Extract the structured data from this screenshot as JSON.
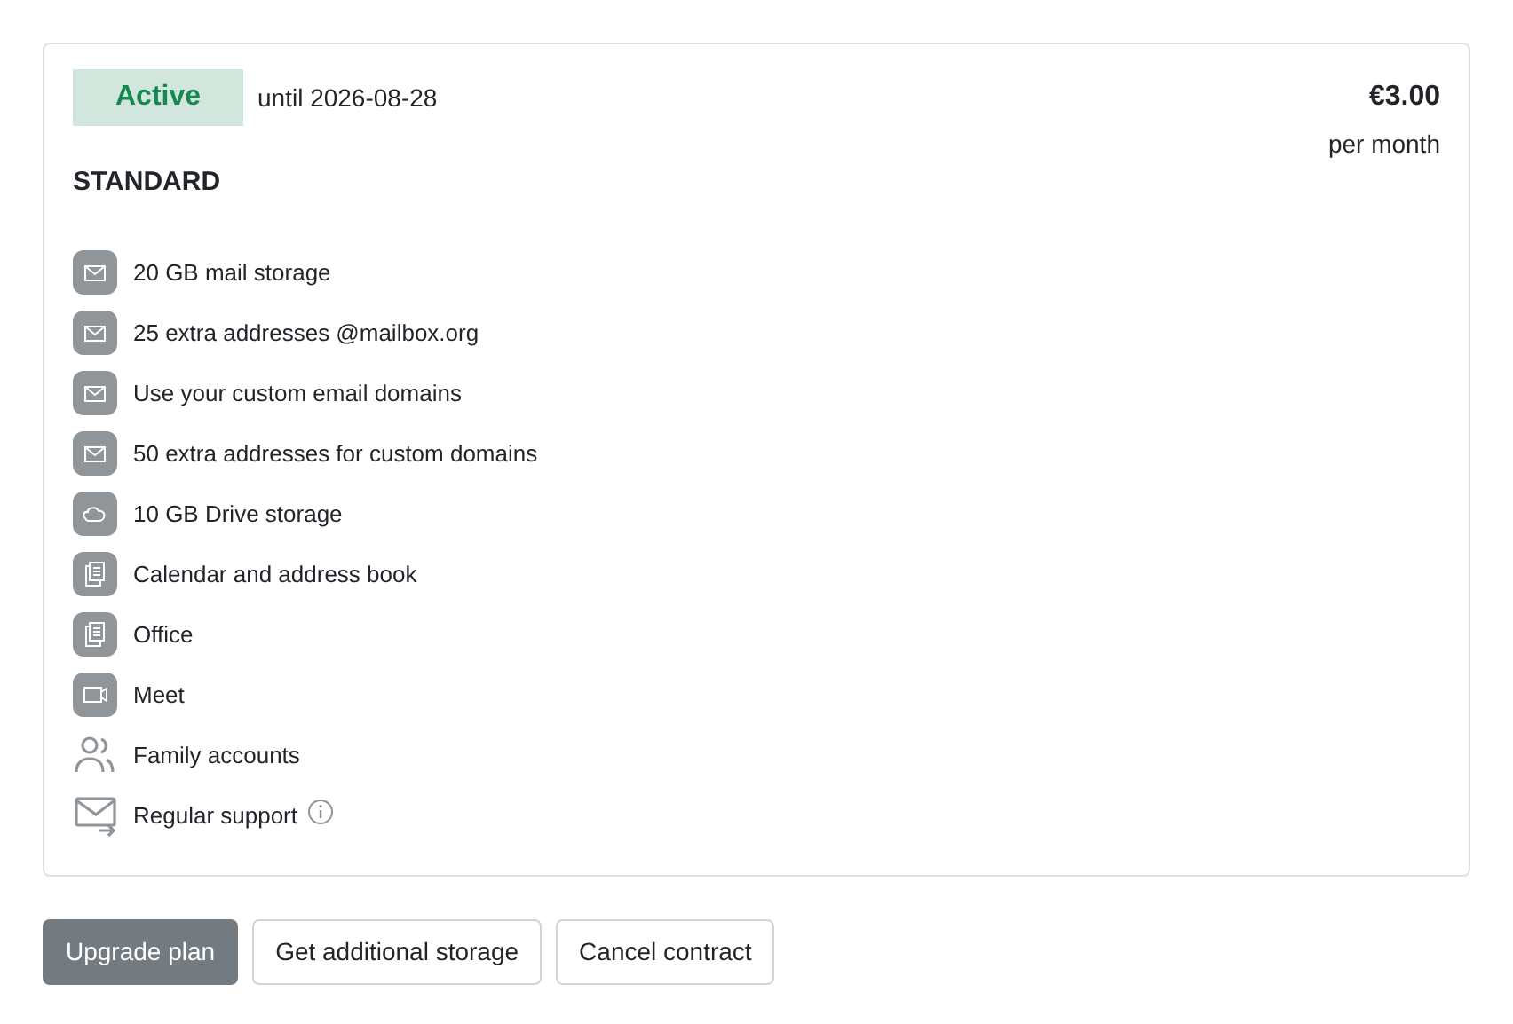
{
  "status": {
    "label": "Active",
    "active": true,
    "until": "until 2026-08-28"
  },
  "plan": {
    "name": "STANDARD",
    "price": "€3.00",
    "period": "per month"
  },
  "features": [
    {
      "kind": "mail",
      "label": "20 GB mail storage"
    },
    {
      "kind": "mail",
      "label": "25 extra addresses @mailbox.org"
    },
    {
      "kind": "mail",
      "label": "Use your custom email domains"
    },
    {
      "kind": "mail",
      "label": "50 extra addresses for custom domains"
    },
    {
      "kind": "cloud",
      "label": "10 GB Drive storage"
    },
    {
      "kind": "docs",
      "label": "Calendar and address book"
    },
    {
      "kind": "docs",
      "label": "Office"
    },
    {
      "kind": "video",
      "label": "Meet"
    },
    {
      "kind": "people",
      "label": "Family accounts"
    },
    {
      "kind": "support",
      "label": "Regular support",
      "info": true
    }
  ],
  "buttons": [
    {
      "kind": "primary",
      "label": "Upgrade plan"
    },
    {
      "kind": "outline",
      "label": "Get additional storage"
    },
    {
      "kind": "outline",
      "label": "Cancel contract"
    }
  ]
}
